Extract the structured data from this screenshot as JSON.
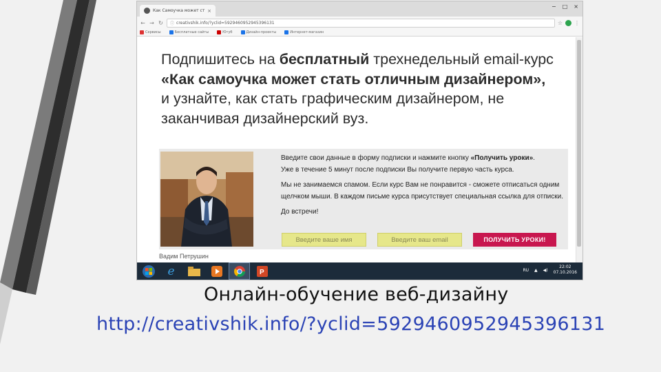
{
  "slide": {
    "caption": "Онлайн-обучение веб-дизайну",
    "link": "http://creativshik.info/?yclid=5929460952945396131"
  },
  "browser": {
    "tab_title": "Как Самоучка может ст...",
    "tab_close": "×",
    "window_controls": [
      "−",
      "□",
      "×"
    ],
    "address_info": "ⓘ",
    "address_url": "creativshik.info/?yclid=5929460952945396131",
    "bookmarks": [
      {
        "label": "Сервисы",
        "color": "#d33"
      },
      {
        "label": "Бесплатные сайты",
        "color": "#1a73e8"
      },
      {
        "label": "Ютуб",
        "color": "#c00"
      },
      {
        "label": "Дизайн-проекты",
        "color": "#1a73e8"
      },
      {
        "label": "Интернет-магазин",
        "color": "#1a73e8"
      }
    ]
  },
  "page": {
    "headline_pre": "Подпишитесь на ",
    "headline_bold": "бесплатный",
    "headline_mid": " трехнедельный email-курс",
    "headline_course": "«Как самоучка может стать отличным дизайнером»,",
    "headline_rest": "и узнайте, как стать графическим дизайнером, не заканчивая дизайнерский вуз.",
    "msg1_pre": "Введите свои данные в форму подписки и нажмите кнопку ",
    "msg1_bold": "«Получить уроки»",
    "msg1_post": ".",
    "msg2": "Уже в течение 5 минут после подписки Вы получите первую часть курса.",
    "msg3": "Мы не занимаемся спамом. Если курс Вам не понравится - сможете отписаться одним щелчком мыши. В каждом письме курса присутствует специальная ссылка для отписки.",
    "msg4": "До встречи!",
    "name_placeholder": "Введите ваше имя",
    "email_placeholder": "Введите ваш email",
    "submit_label": "ПОЛУЧИТЬ УРОКИ!",
    "author": "Вадим Петрушин"
  },
  "taskbar": {
    "apps": [
      "windows-start",
      "internet-explorer",
      "file-explorer",
      "media-player",
      "chrome",
      "powerpoint"
    ],
    "language": "RU",
    "time": "22:02",
    "date": "07.10.2016"
  }
}
